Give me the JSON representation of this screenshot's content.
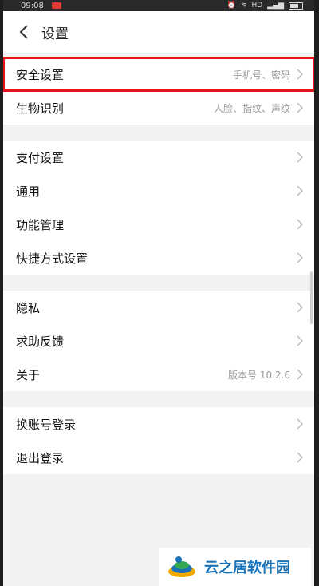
{
  "status": {
    "time": "09:08",
    "network": "HD"
  },
  "header": {
    "title": "设置"
  },
  "groups": [
    {
      "items": [
        {
          "label": "安全设置",
          "detail": "手机号、密码"
        },
        {
          "label": "生物识别",
          "detail": "人脸、指纹、声纹"
        }
      ]
    },
    {
      "items": [
        {
          "label": "支付设置",
          "detail": ""
        },
        {
          "label": "通用",
          "detail": ""
        },
        {
          "label": "功能管理",
          "detail": ""
        },
        {
          "label": "快捷方式设置",
          "detail": ""
        }
      ]
    },
    {
      "items": [
        {
          "label": "隐私",
          "detail": ""
        },
        {
          "label": "求助反馈",
          "detail": ""
        },
        {
          "label": "关于",
          "detail": "版本号 10.2.6"
        }
      ]
    },
    {
      "items": [
        {
          "label": "换账号登录",
          "detail": ""
        },
        {
          "label": "退出登录",
          "detail": ""
        }
      ]
    }
  ],
  "watermark": {
    "text": "云之居软件园"
  },
  "colors": {
    "highlight": "#e8141b",
    "accent": "#1a73b8"
  }
}
